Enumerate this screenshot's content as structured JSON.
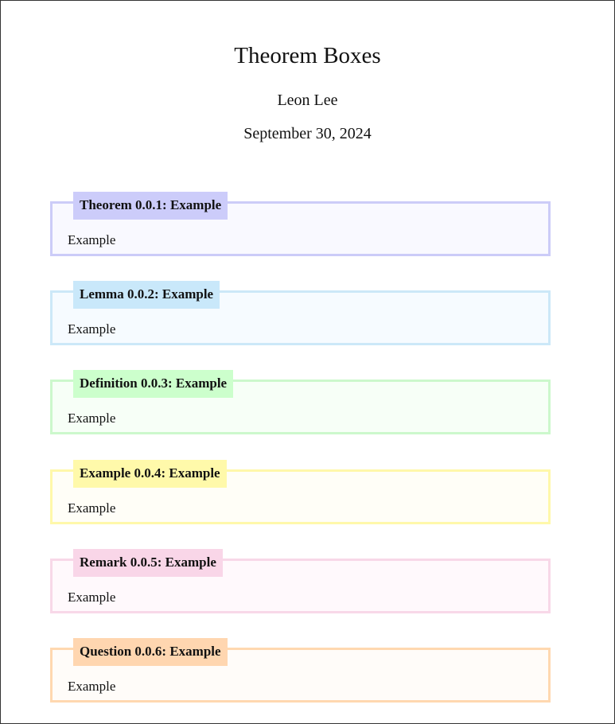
{
  "document": {
    "title": "Theorem Boxes",
    "author": "Leon Lee",
    "date": "September 30, 2024"
  },
  "boxes": [
    {
      "title": "Theorem 0.0.1: Example",
      "body": "Example",
      "border_color": "#CCCCF8",
      "fill_color": "#F9F9FF",
      "title_bg": "#CCCCFA"
    },
    {
      "title": "Lemma 0.0.2: Example",
      "body": "Example",
      "border_color": "#CCE8F8",
      "fill_color": "#F6FBFF",
      "title_bg": "#C9E8FA"
    },
    {
      "title": "Definition 0.0.3: Example",
      "body": "Example",
      "border_color": "#CCF8CC",
      "fill_color": "#F7FFF7",
      "title_bg": "#CCFFCC"
    },
    {
      "title": "Example 0.0.4: Example",
      "body": "Example",
      "border_color": "#FFF8AA",
      "fill_color": "#FFFEF7",
      "title_bg": "#FFF9AA"
    },
    {
      "title": "Remark 0.0.5: Example",
      "body": "Example",
      "border_color": "#F8D8E8",
      "fill_color": "#FFF9FC",
      "title_bg": "#F9D6E8"
    },
    {
      "title": "Question 0.0.6: Example",
      "body": "Example",
      "border_color": "#FFD8B0",
      "fill_color": "#FFFCF9",
      "title_bg": "#FFD6B0"
    }
  ]
}
